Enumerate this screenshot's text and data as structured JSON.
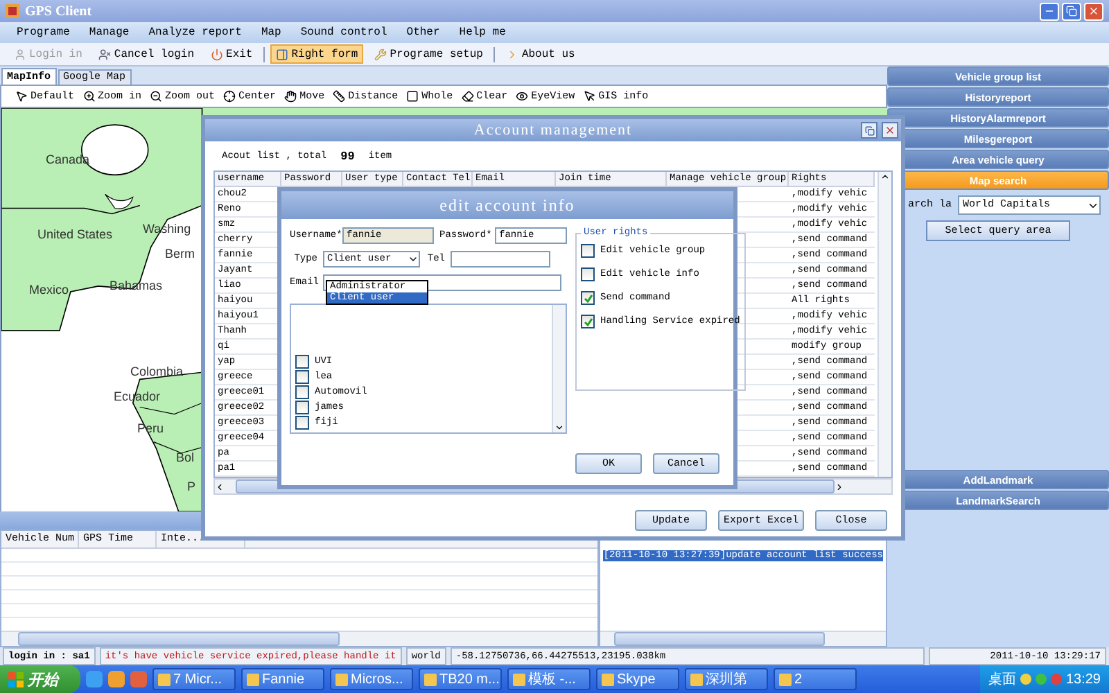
{
  "window": {
    "title": "GPS Client"
  },
  "menu": [
    "Programe",
    "Manage",
    "Analyze report",
    "Map",
    "Sound control",
    "Other",
    "Help me"
  ],
  "toolbar": [
    {
      "label": "Login in",
      "disabled": true,
      "selected": false
    },
    {
      "label": "Cancel login",
      "disabled": false,
      "selected": false
    },
    {
      "label": "Exit",
      "disabled": false,
      "selected": false
    },
    {
      "label": "Right form",
      "disabled": false,
      "selected": true
    },
    {
      "label": "Programe setup",
      "disabled": false,
      "selected": false
    },
    {
      "label": "About us",
      "disabled": false,
      "selected": false
    }
  ],
  "map_tabs": [
    {
      "label": "MapInfo",
      "selected": true
    },
    {
      "label": "Google Map",
      "selected": false
    }
  ],
  "map_tools": [
    "Default",
    "Zoom in",
    "Zoom out",
    "Center",
    "Move",
    "Distance",
    "Whole",
    "Clear",
    "EyeView",
    "GIS info"
  ],
  "map_labels": [
    "Canada",
    "United States",
    "Washing",
    "Berm",
    "Mexico",
    "Bahamas",
    "Colombia",
    "Ecuador",
    "Peru",
    "Bol",
    "P"
  ],
  "vehicle_table": {
    "columns": [
      "Vehicle Num",
      "GPS Time",
      "Inte..."
    ]
  },
  "log": {
    "entries": [
      {
        "text": "[2011-10-10 13:27:39]update account list success",
        "selected": true
      }
    ]
  },
  "side_nav": [
    {
      "label": "Vehicle group list",
      "selected": false
    },
    {
      "label": "Historyreport",
      "selected": false
    },
    {
      "label": "HistoryAlarmreport",
      "selected": false
    },
    {
      "label": "Milesgereport",
      "selected": false
    },
    {
      "label": "Area vehicle query",
      "selected": false
    },
    {
      "label": "Map search",
      "selected": true
    }
  ],
  "map_search": {
    "label": "arch la",
    "layer": "World Capitals",
    "button": "Select query area"
  },
  "landmark_nav": [
    "AddLandmark",
    "LandmarkSearch"
  ],
  "status_bar": {
    "login": "login in : sa1",
    "alert": "it's have vehicle service expired,please handle it",
    "layer": "world",
    "coordinates": "-58.12750736,66.44275513,23195.038km",
    "datetime": "2011-10-10 13:29:17"
  },
  "taskbar": {
    "start": "开始",
    "items": [
      "7 Micr...",
      "Fannie",
      "Micros...",
      "TB20 m...",
      "模板 -...",
      "Skype",
      "深圳第",
      "2"
    ],
    "tray_label": "桌面",
    "clock": "13:29"
  },
  "account_dialog": {
    "title": "Account management",
    "count_label": "Acout list , total",
    "count": "99",
    "count_unit": "item",
    "columns": [
      "username",
      "Password",
      "User type",
      "Contact Tel",
      "Email",
      "Join time",
      "Manage vehicle group",
      "Rights"
    ],
    "rows": [
      {
        "username": "chou2",
        "rights": ",modify vehic"
      },
      {
        "username": "Reno",
        "rights": ",modify vehic"
      },
      {
        "username": "smz",
        "rights": ",modify vehic"
      },
      {
        "username": "cherry",
        "rights": ",send command"
      },
      {
        "username": "fannie",
        "rights": ",send command"
      },
      {
        "username": "Jayant",
        "rights": ",send command"
      },
      {
        "username": "liao",
        "rights": ",send command"
      },
      {
        "username": "haiyou",
        "rights": "All rights"
      },
      {
        "username": "haiyou1",
        "rights": ",modify vehic"
      },
      {
        "username": "Thanh",
        "rights": ",modify vehic"
      },
      {
        "username": "qi",
        "rights": "modify group"
      },
      {
        "username": "yap",
        "rights": ",send command"
      },
      {
        "username": "greece",
        "rights": ",send command"
      },
      {
        "username": "greece01",
        "rights": ",send command"
      },
      {
        "username": "greece02",
        "rights": ",send command"
      },
      {
        "username": "greece03",
        "rights": ",send command"
      },
      {
        "username": "greece04",
        "rights": ",send command"
      },
      {
        "username": "pa",
        "rights": ",send command"
      },
      {
        "username": "pa1",
        "rights": ",send command"
      }
    ],
    "buttons": [
      "Update",
      "Export Excel",
      "Close"
    ]
  },
  "edit_dialog": {
    "title": "edit account info",
    "username_label": "Username*",
    "username": "fannie",
    "password_label": "Password*",
    "password": "fannie",
    "type_label": "Type",
    "type": "Client user",
    "type_options": [
      {
        "label": "Administrator",
        "selected": false
      },
      {
        "label": "Client user",
        "selected": true
      }
    ],
    "tel_label": "Tel",
    "email_label": "Email",
    "groups": [
      {
        "label": "UVI",
        "checked": false
      },
      {
        "label": "lea",
        "checked": false
      },
      {
        "label": "Automovil",
        "checked": false
      },
      {
        "label": "james",
        "checked": false
      },
      {
        "label": "fiji",
        "checked": false
      }
    ],
    "rights_title": "User rights",
    "rights": [
      {
        "label": "Edit vehicle group",
        "checked": false
      },
      {
        "label": "Edit vehicle info",
        "checked": false
      },
      {
        "label": "Send command",
        "checked": true
      },
      {
        "label": "Handling Service expired",
        "checked": true
      }
    ],
    "buttons": [
      "OK",
      "Cancel"
    ]
  }
}
